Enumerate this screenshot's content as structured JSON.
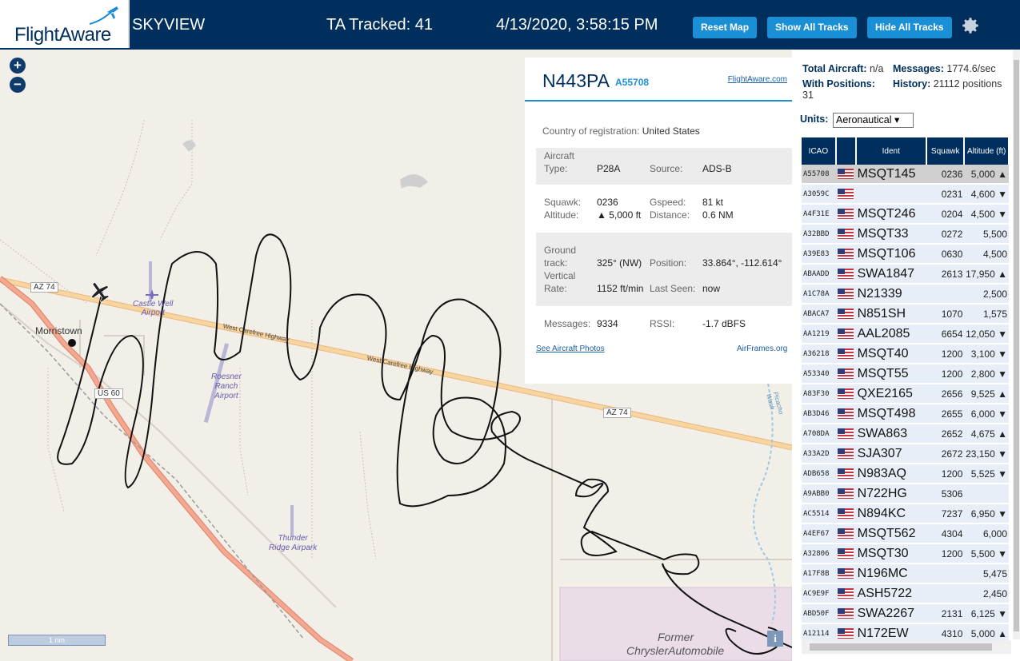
{
  "header": {
    "logo": "FlightAware",
    "app_title": "SKYVIEW",
    "tracked": "TA Tracked: 41",
    "datetime": "4/13/2020, 3:58:15 PM",
    "reset_map": "Reset Map",
    "show_all_tracks": "Show All Tracks",
    "hide_all_tracks": "Hide All Tracks",
    "settings_icon": "gear-icon"
  },
  "map": {
    "zoom_in": "+",
    "zoom_out": "−",
    "scale_label": "1 nm",
    "info": "i",
    "labels": {
      "az74_a": "AZ 74",
      "az74_b": "AZ 74",
      "us60": "US 60",
      "morristown": "Morristown",
      "castle_well": "Castle Well",
      "castle_well2": "Airport",
      "roesner1": "Roesner",
      "roesner2": "Ranch",
      "roesner3": "Airport",
      "thunder1": "Thunder",
      "thunder2": "Ridge Airpark",
      "wc_hwy1": "West Carefree Highway",
      "wc_hwy2": "West Carefree Highway",
      "wash": "Picacho Wash",
      "former": "Former",
      "chrysler": "ChryslerAutomobile"
    }
  },
  "aircraft": {
    "registration": "N443PA",
    "hex": "A55708",
    "fa_link": "FlightAware.com",
    "country_label": "Country of registration:",
    "country": "United States",
    "type_label1": "Aircraft",
    "type_label2": "Type:",
    "type": "P28A",
    "source_label": "Source:",
    "source": "ADS-B",
    "squawk_label": "Squawk:",
    "squawk": "0236",
    "gspeed_label": "Gspeed:",
    "gspeed": "81 kt",
    "altitude_label": "Altitude:",
    "altitude": "▲ 5,000 ft",
    "distance_label": "Distance:",
    "distance": "0.6 NM",
    "gtrack_label1": "Ground",
    "gtrack_label2": "track:",
    "gtrack": "325° (NW)",
    "position_label": "Position:",
    "position": "33.864°, -112.614°",
    "vrate_label1": "Vertical",
    "vrate_label2": "Rate:",
    "vrate": "1152 ft/min",
    "lastseen_label": "Last Seen:",
    "lastseen": "now",
    "messages_label": "Messages:",
    "messages": "9334",
    "rssi_label": "RSSI:",
    "rssi": "-1.7 dBFS",
    "photos_link": "See Aircraft Photos",
    "airframes_link": "AirFrames.org"
  },
  "stats": {
    "total_label": "Total Aircraft:",
    "total": "n/a",
    "messages_label": "Messages:",
    "messages": "1774.6/sec",
    "withpos_label": "With Positions:",
    "withpos": "31",
    "history_label": "History:",
    "history": "21112 positions",
    "units_label": "Units:",
    "units_value": "Aeronautical ▾"
  },
  "table": {
    "headers": [
      "ICAO",
      "",
      "Ident",
      "Squawk",
      "Altitude (ft)"
    ],
    "rows": [
      {
        "icao": "A55708",
        "ident": "MSQT145",
        "squawk": "0236",
        "alt": "5,000 ▲"
      },
      {
        "icao": "A3059C",
        "ident": "",
        "squawk": "0231",
        "alt": "4,600 ▼"
      },
      {
        "icao": "A4F31E",
        "ident": "MSQT246",
        "squawk": "0204",
        "alt": "4,500 ▼"
      },
      {
        "icao": "A32BBD",
        "ident": "MSQT33",
        "squawk": "0272",
        "alt": "5,500"
      },
      {
        "icao": "A39E83",
        "ident": "MSQT106",
        "squawk": "0630",
        "alt": "4,500"
      },
      {
        "icao": "ABAADD",
        "ident": "SWA1847",
        "squawk": "2613",
        "alt": "17,950 ▲"
      },
      {
        "icao": "A1C78A",
        "ident": "N21339",
        "squawk": "",
        "alt": "2,500"
      },
      {
        "icao": "ABACA7",
        "ident": "N851SH",
        "squawk": "1070",
        "alt": "1,575"
      },
      {
        "icao": "AA1219",
        "ident": "AAL2085",
        "squawk": "6654",
        "alt": "12,050 ▼"
      },
      {
        "icao": "A36218",
        "ident": "MSQT40",
        "squawk": "1200",
        "alt": "3,100 ▼"
      },
      {
        "icao": "A53340",
        "ident": "MSQT55",
        "squawk": "1200",
        "alt": "2,800 ▼"
      },
      {
        "icao": "A83F30",
        "ident": "QXE2165",
        "squawk": "2656",
        "alt": "9,525 ▲"
      },
      {
        "icao": "AB3D46",
        "ident": "MSQT498",
        "squawk": "2655",
        "alt": "6,000 ▼"
      },
      {
        "icao": "A708DA",
        "ident": "SWA863",
        "squawk": "2652",
        "alt": "4,675 ▲"
      },
      {
        "icao": "A33A2D",
        "ident": "SJA307",
        "squawk": "2672",
        "alt": "23,150 ▼"
      },
      {
        "icao": "ADB658",
        "ident": "N983AQ",
        "squawk": "1200",
        "alt": "5,525 ▼"
      },
      {
        "icao": "A9ABB0",
        "ident": "N722HG",
        "squawk": "5306",
        "alt": ""
      },
      {
        "icao": "AC5514",
        "ident": "N894KC",
        "squawk": "7237",
        "alt": "6,950 ▼"
      },
      {
        "icao": "A4EF67",
        "ident": "MSQT562",
        "squawk": "4304",
        "alt": "6,000"
      },
      {
        "icao": "A32806",
        "ident": "MSQT30",
        "squawk": "1200",
        "alt": "5,500 ▼"
      },
      {
        "icao": "A17F8B",
        "ident": "N196MC",
        "squawk": "",
        "alt": "5,475"
      },
      {
        "icao": "AC9E9F",
        "ident": "ASH5722",
        "squawk": "",
        "alt": "2,450"
      },
      {
        "icao": "ABD50F",
        "ident": "SWA2267",
        "squawk": "2131",
        "alt": "6,125 ▼"
      },
      {
        "icao": "A12114",
        "ident": "N172EW",
        "squawk": "4310",
        "alt": "5,000 ▲"
      }
    ]
  },
  "colors": {
    "header_bg": "#002f5d",
    "button_bg": "#1a8fd6",
    "map_bg": "#f2efe9",
    "highway": "#f7c88a",
    "us60": "#f0a08c"
  }
}
